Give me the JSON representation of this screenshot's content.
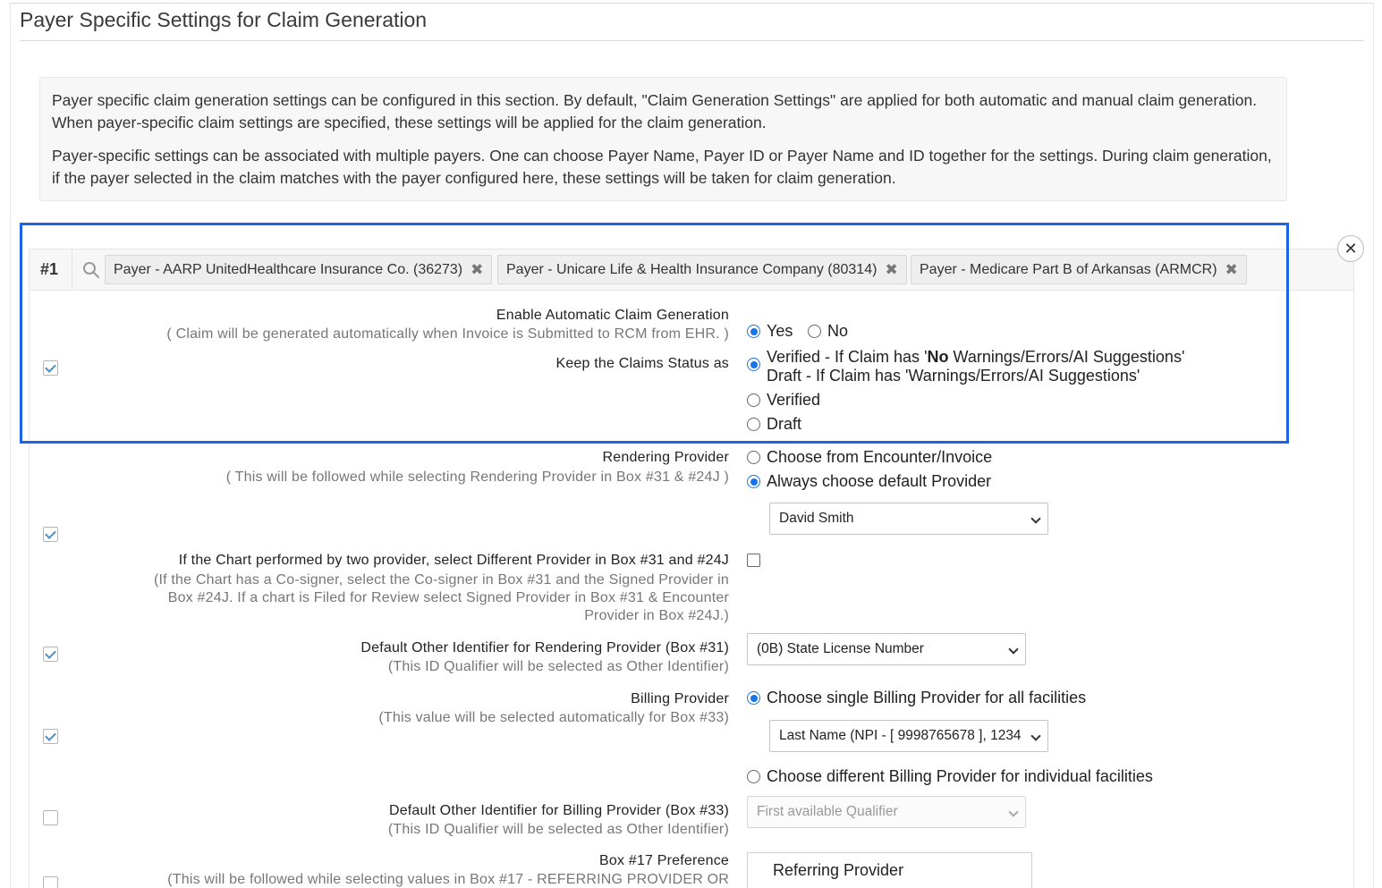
{
  "page": {
    "title": "Payer Specific Settings for Claim Generation",
    "info_paragraphs": [
      "Payer specific claim generation settings can be configured in this section. By default, \"Claim Generation Settings\" are applied for both automatic and manual claim generation. When payer-specific claim settings are specified, these settings will be applied for the claim generation.",
      "Payer-specific settings can be associated with multiple payers. One can choose Payer Name, Payer ID or Payer Name and ID together for the settings. During claim generation, if the payer selected in the claim matches with the payer configured here, these settings will be taken for claim generation."
    ]
  },
  "card": {
    "number": "#1",
    "payers": [
      "Payer - AARP UnitedHealthcare Insurance Co. (36273)",
      "Payer - Unicare Life & Health Insurance Company (80314)",
      "Payer - Medicare Part B of Arkansas (ARMCR)"
    ]
  },
  "settings": {
    "auto_claim": {
      "label": "Enable Automatic Claim Generation",
      "sub": "( Claim will be generated automatically when Invoice is Submitted to RCM from EHR. )",
      "opt_yes": "Yes",
      "opt_no": "No"
    },
    "claim_status": {
      "label": "Keep the Claims Status as",
      "opt1_a": "Verified - If Claim has '",
      "opt1_b": "No",
      "opt1_c": " Warnings/Errors/AI Suggestions'",
      "opt1_line2": "Draft - If Claim has 'Warnings/Errors/AI Suggestions'",
      "opt2": "Verified",
      "opt3": "Draft"
    },
    "rendering_provider": {
      "label": "Rendering Provider",
      "sub": "( This will be followed while selecting Rendering Provider in Box #31 & #24J )",
      "opt1": "Choose from Encounter/Invoice",
      "opt2": "Always choose default Provider",
      "selected": "David Smith"
    },
    "two_provider": {
      "label": "If the Chart performed by two provider, select Different Provider in Box #31 and #24J",
      "sub_line1": "(If the Chart has a Co-signer, select the Co-signer in Box #31 and the Signed Provider in",
      "sub_line2": "Box #24J. If a chart is Filed for Review select Signed Provider in Box #31 & Encounter",
      "sub_line3": "Provider in Box #24J.)"
    },
    "other_id_rendering": {
      "label": "Default Other Identifier for Rendering Provider (Box #31)",
      "sub": "(This ID Qualifier will be selected as Other Identifier)",
      "selected": "(0B) State License Number"
    },
    "billing_provider": {
      "label": "Billing Provider",
      "sub": "(This value will be selected automatically for Box #33)",
      "opt1": "Choose single Billing Provider for all facilities",
      "selected": "Last Name (NPI - [ 9998765678 ], 1234",
      "opt2": "Choose different Billing Provider for individual facilities"
    },
    "other_id_billing": {
      "label": "Default Other Identifier for Billing Provider (Box #33)",
      "sub": "(This ID Qualifier will be selected as Other Identifier)",
      "selected": "First available Qualifier"
    },
    "box17": {
      "label": "Box #17 Preference",
      "sub": "(This will be followed while selecting values in Box #17 - REFERRING PROVIDER OR",
      "value": "Referring Provider"
    }
  },
  "colors": {
    "highlight_border": "#1d63e6",
    "radio_selected": "#1a73e8",
    "checkmark": "#4a90c8"
  }
}
